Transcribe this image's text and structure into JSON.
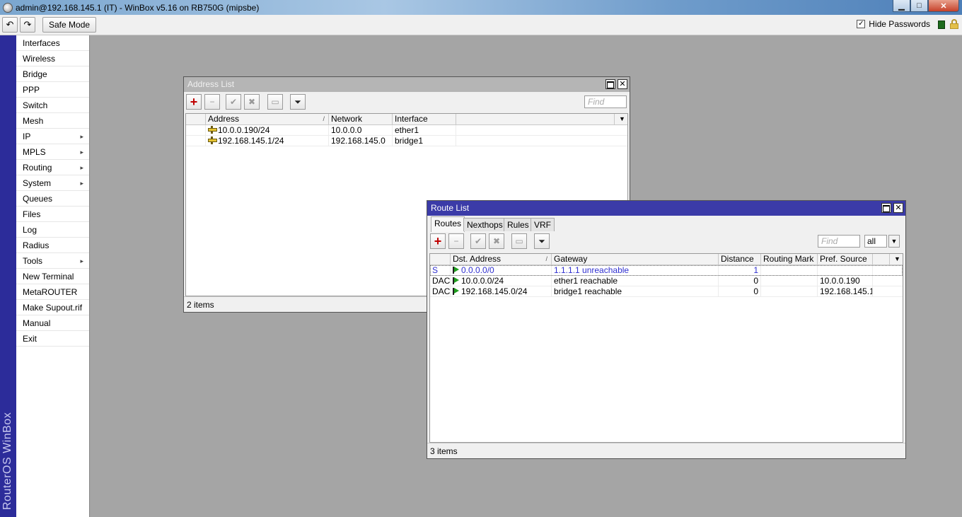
{
  "window": {
    "title": "admin@192.168.145.1 (IT) - WinBox v5.16 on RB750G (mipsbe)",
    "controls": {
      "minimize": "▁",
      "maximize": "□",
      "close": "✕"
    }
  },
  "toolbar": {
    "undo_icon": "↶",
    "redo_icon": "↷",
    "safe_mode_label": "Safe Mode",
    "hide_passwords_label": "Hide Passwords",
    "hide_passwords_checked": "✓"
  },
  "brand": "RouterOS WinBox",
  "menu": [
    {
      "label": "Interfaces",
      "arrow": ""
    },
    {
      "label": "Wireless",
      "arrow": ""
    },
    {
      "label": "Bridge",
      "arrow": ""
    },
    {
      "label": "PPP",
      "arrow": ""
    },
    {
      "label": "Switch",
      "arrow": ""
    },
    {
      "label": "Mesh",
      "arrow": ""
    },
    {
      "label": "IP",
      "arrow": "▸"
    },
    {
      "label": "MPLS",
      "arrow": "▸"
    },
    {
      "label": "Routing",
      "arrow": "▸"
    },
    {
      "label": "System",
      "arrow": "▸"
    },
    {
      "label": "Queues",
      "arrow": ""
    },
    {
      "label": "Files",
      "arrow": ""
    },
    {
      "label": "Log",
      "arrow": ""
    },
    {
      "label": "Radius",
      "arrow": ""
    },
    {
      "label": "Tools",
      "arrow": "▸"
    },
    {
      "label": "New Terminal",
      "arrow": ""
    },
    {
      "label": "MetaROUTER",
      "arrow": ""
    },
    {
      "label": "Make Supout.rif",
      "arrow": ""
    },
    {
      "label": "Manual",
      "arrow": ""
    },
    {
      "label": "Exit",
      "arrow": ""
    }
  ],
  "address_list": {
    "title": "Address List",
    "find_placeholder": "Find",
    "columns": [
      "Address",
      "Network",
      "Interface"
    ],
    "rows": [
      {
        "address": "10.0.0.190/24",
        "network": "10.0.0.0",
        "interface": "ether1"
      },
      {
        "address": "192.168.145.1/24",
        "network": "192.168.145.0",
        "interface": "bridge1"
      }
    ],
    "status": "2 items"
  },
  "route_list": {
    "title": "Route List",
    "tabs": [
      "Routes",
      "Nexthops",
      "Rules",
      "VRF"
    ],
    "find_placeholder": "Find",
    "filter_value": "all",
    "columns": [
      "Dst. Address",
      "Gateway",
      "Distance",
      "Routing Mark",
      "Pref. Source"
    ],
    "rows": [
      {
        "flags": "S",
        "dst": "0.0.0.0/0",
        "gateway": "1.1.1.1 unreachable",
        "distance": "1",
        "mark": "",
        "pref_source": ""
      },
      {
        "flags": "DAC",
        "dst": "10.0.0.0/24",
        "gateway": "ether1 reachable",
        "distance": "0",
        "mark": "",
        "pref_source": "10.0.0.190"
      },
      {
        "flags": "DAC",
        "dst": "192.168.145.0/24",
        "gateway": "bridge1 reachable",
        "distance": "0",
        "mark": "",
        "pref_source": "192.168.145.1"
      }
    ],
    "status": "3 items"
  },
  "icons": {
    "add": "+",
    "remove": "−",
    "enable": "✔",
    "disable": "✖",
    "comment": "▭",
    "filter": "⏷",
    "dropdown": "▼"
  }
}
